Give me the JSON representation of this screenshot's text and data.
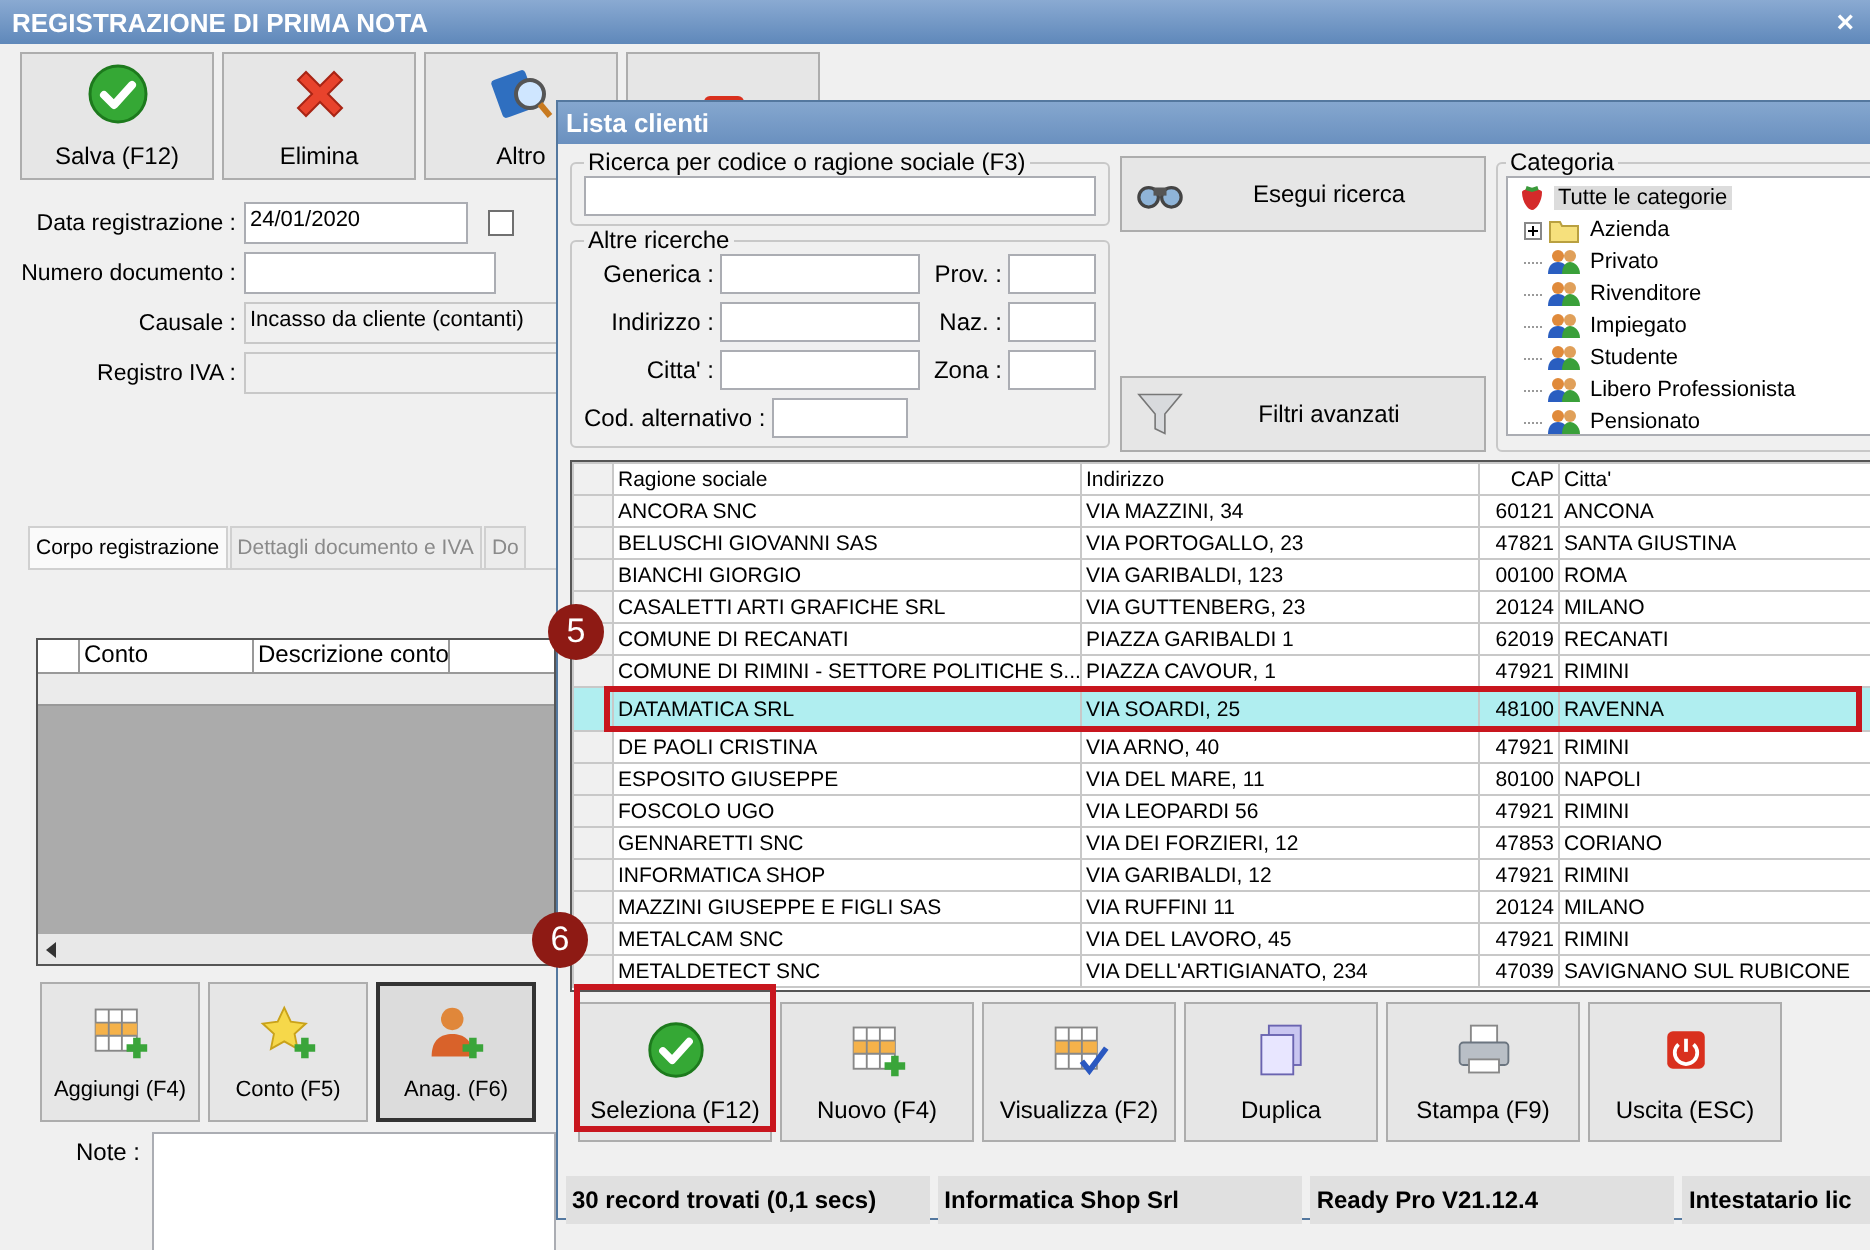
{
  "window": {
    "title": "REGISTRAZIONE DI PRIMA NOTA",
    "close": "×"
  },
  "toolbar": [
    {
      "kind": "save",
      "label": "Salva (F12)"
    },
    {
      "kind": "delete",
      "label": "Elimina"
    },
    {
      "kind": "search",
      "label": "Altro"
    },
    {
      "kind": "power"
    }
  ],
  "form": {
    "fields": [
      {
        "label": "Data registrazione :",
        "value": "24/01/2020",
        "kind": "input"
      },
      {
        "label": "Numero documento :",
        "kind": "input"
      },
      {
        "label": "Causale :",
        "value": "Incasso da cliente (contanti)",
        "kind": "readonly"
      },
      {
        "label": "Registro IVA :",
        "kind": "readonly"
      }
    ],
    "checkbox": {
      "checked": false
    }
  },
  "tabs": [
    {
      "label": "Corpo registrazione",
      "selected": true
    },
    {
      "label": "Dettagli documento e IVA",
      "selected": false
    },
    {
      "label": "Do",
      "selected": false
    }
  ],
  "grid": {
    "columns": [
      "Conto",
      "Descrizione conto"
    ]
  },
  "actions": [
    {
      "kind": "grid-add",
      "label": "Aggiungi (F4)",
      "pressed": false
    },
    {
      "kind": "star-add",
      "label": "Conto (F5)",
      "pressed": false
    },
    {
      "kind": "person-add",
      "label": "Anag. (F6)",
      "pressed": true
    }
  ],
  "note": {
    "label": "Note :"
  },
  "dialog": {
    "title": "Lista clienti",
    "search": {
      "title": "Ricerca per codice o ragione sociale (F3)"
    },
    "other": {
      "title": "Altre ricerche",
      "fields": [
        {
          "label": "Generica :"
        },
        {
          "label": "Prov. :"
        },
        {
          "label": "Indirizzo :"
        },
        {
          "label": "Naz. :"
        },
        {
          "label": "Citta' :"
        },
        {
          "label": "Zona :"
        },
        {
          "label": "Cod. alternativo :"
        }
      ]
    },
    "buttons": [
      {
        "kind": "binoculars",
        "label": "Esegui ricerca"
      },
      {
        "kind": "funnel",
        "label": "Filtri avanzati"
      }
    ],
    "category": {
      "title": "Categoria",
      "tree": {
        "label": "Tutte le categorie",
        "selected": true,
        "children": [
          {
            "label": "Azienda",
            "kind": "folder",
            "expanded": false,
            "selected": false
          },
          {
            "label": "Privato",
            "kind": "group",
            "selected": false
          },
          {
            "label": "Rivenditore",
            "kind": "group",
            "selected": false
          },
          {
            "label": "Impiegato",
            "kind": "group",
            "selected": false
          },
          {
            "label": "Studente",
            "kind": "group",
            "selected": false
          },
          {
            "label": "Libero Professionista",
            "kind": "group",
            "selected": false
          },
          {
            "label": "Pensionato",
            "kind": "group",
            "selected": false
          }
        ]
      }
    },
    "table": {
      "columns": [
        "Ragione sociale",
        "Indirizzo",
        "CAP",
        "Citta'"
      ],
      "rows": [
        {
          "cells": [
            "ANCORA SNC",
            "VIA MAZZINI, 34",
            "60121",
            "ANCONA"
          ],
          "selected": false
        },
        {
          "cells": [
            "BELUSCHI GIOVANNI SAS",
            "VIA PORTOGALLO, 23",
            "47821",
            "SANTA GIUSTINA"
          ],
          "selected": false
        },
        {
          "cells": [
            "BIANCHI GIORGIO",
            "VIA GARIBALDI, 123",
            "00100",
            "ROMA"
          ],
          "selected": false
        },
        {
          "cells": [
            "CASALETTI ARTI GRAFICHE SRL",
            "VIA GUTTENBERG, 23",
            "20124",
            "MILANO"
          ],
          "selected": false
        },
        {
          "cells": [
            "COMUNE DI RECANATI",
            "PIAZZA GARIBALDI 1",
            "62019",
            "RECANATI"
          ],
          "selected": false
        },
        {
          "cells": [
            "COMUNE DI RIMINI - SETTORE POLITICHE S...",
            "PIAZZA CAVOUR, 1",
            "47921",
            "RIMINI"
          ],
          "selected": false
        },
        {
          "cells": [
            "DATAMATICA SRL",
            "VIA SOARDI, 25",
            "48100",
            "RAVENNA"
          ],
          "selected": true
        },
        {
          "cells": [
            "DE PAOLI CRISTINA",
            "VIA ARNO, 40",
            "47921",
            "RIMINI"
          ],
          "selected": false
        },
        {
          "cells": [
            "ESPOSITO GIUSEPPE",
            "VIA DEL MARE, 11",
            "80100",
            "NAPOLI"
          ],
          "selected": false
        },
        {
          "cells": [
            "FOSCOLO UGO",
            "VIA LEOPARDI 56",
            "47921",
            "RIMINI"
          ],
          "selected": false
        },
        {
          "cells": [
            "GENNARETTI SNC",
            "VIA DEI FORZIERI, 12",
            "47853",
            "CORIANO"
          ],
          "selected": false
        },
        {
          "cells": [
            "INFORMATICA SHOP",
            "VIA GARIBALDI, 12",
            "47921",
            "RIMINI"
          ],
          "selected": false
        },
        {
          "cells": [
            "MAZZINI GIUSEPPE E FIGLI SAS",
            "VIA RUFFINI 11",
            "20124",
            "MILANO"
          ],
          "selected": false
        },
        {
          "cells": [
            "METALCAM SNC",
            "VIA DEL LAVORO, 45",
            "47921",
            "RIMINI"
          ],
          "selected": false
        },
        {
          "cells": [
            "METALDETECT SNC",
            "VIA DELL'ARTIGIANATO, 234",
            "47039",
            "SAVIGNANO SUL RUBICONE"
          ],
          "selected": false
        }
      ]
    },
    "actions": [
      {
        "kind": "check",
        "label": "Seleziona (F12)"
      },
      {
        "kind": "grid-add",
        "label": "Nuovo (F4)"
      },
      {
        "kind": "grid-check",
        "label": "Visualizza (F2)"
      },
      {
        "kind": "copies",
        "label": "Duplica"
      },
      {
        "kind": "printer",
        "label": "Stampa (F9)"
      },
      {
        "kind": "power",
        "label": "Uscita (ESC)"
      }
    ],
    "status": [
      "30 record trovati (0,1 secs)",
      "Informatica Shop Srl",
      "Ready Pro V21.12.4",
      "Intestatario lic"
    ]
  },
  "annotations": [
    {
      "number": "5",
      "kind": "row"
    },
    {
      "number": "6",
      "kind": "button"
    }
  ]
}
